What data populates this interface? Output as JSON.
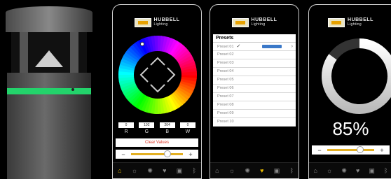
{
  "brand": {
    "name": "HUBBELL",
    "sub": "Lighting"
  },
  "screen1": {
    "rgbw": [
      {
        "label": "R",
        "value": "0"
      },
      {
        "label": "G",
        "value": "102"
      },
      {
        "label": "B",
        "value": "204"
      },
      {
        "label": "W",
        "value": "0"
      }
    ],
    "clear_label": "Clear Values",
    "brightness_level": 0.7,
    "minus": "−",
    "plus": "+"
  },
  "screen2": {
    "title": "Presets",
    "items": [
      "Preset 01",
      "Preset 02",
      "Preset 03",
      "Preset 04",
      "Preset 05",
      "Preset 06",
      "Preset 07",
      "Preset 08",
      "Preset 09",
      "Preset 10"
    ],
    "selected": 0
  },
  "screen3": {
    "percent_label": "85%",
    "level": 0.85
  },
  "nav_icons": [
    "home-icon",
    "bulb-icon",
    "sun-icon",
    "heart-icon",
    "camera-icon",
    "bluetooth-icon"
  ],
  "colors": {
    "accent": "#e6b800",
    "preset_bar": "#3a78c8",
    "clear_text": "#d32222"
  }
}
